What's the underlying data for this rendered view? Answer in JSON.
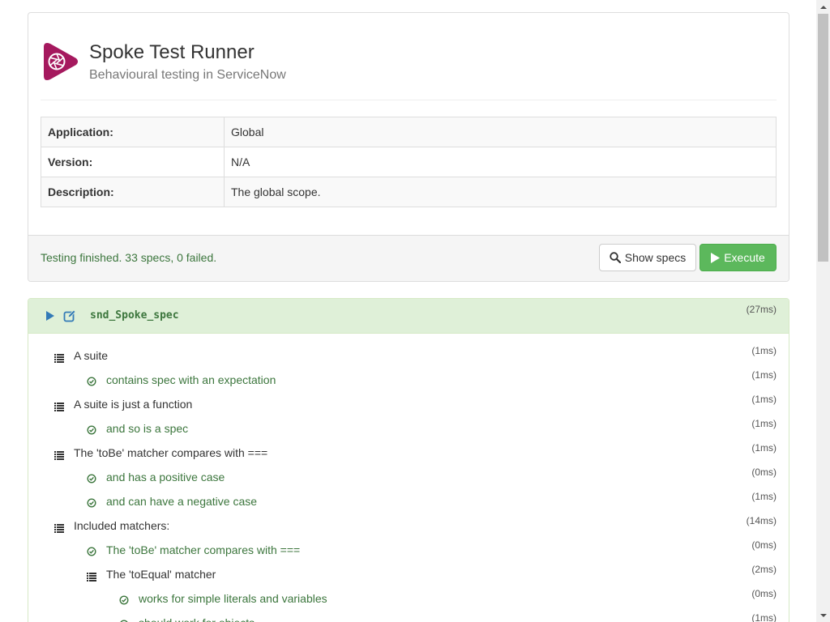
{
  "header": {
    "title": "Spoke Test Runner",
    "subtitle": "Behavioural testing in ServiceNow",
    "logo_color": "#a5195e"
  },
  "info": [
    {
      "label": "Application:",
      "value": "Global"
    },
    {
      "label": "Version:",
      "value": "N/A"
    },
    {
      "label": "Description:",
      "value": "The global scope."
    }
  ],
  "footer": {
    "status": "Testing finished. 33 specs, 0 failed.",
    "show_specs_label": "Show specs",
    "execute_label": "Execute"
  },
  "results": {
    "spec_file": "snd_Spoke_spec",
    "spec_time": "(27ms)",
    "items": [
      {
        "type": "suite",
        "depth": 0,
        "label": "A suite",
        "time": "(1ms)"
      },
      {
        "type": "spec",
        "depth": 1,
        "label": "contains spec with an expectation",
        "time": "(1ms)"
      },
      {
        "type": "suite",
        "depth": 0,
        "label": "A suite is just a function",
        "time": "(1ms)"
      },
      {
        "type": "spec",
        "depth": 1,
        "label": "and so is a spec",
        "time": "(1ms)"
      },
      {
        "type": "suite",
        "depth": 0,
        "label": "The 'toBe' matcher compares with ===",
        "time": "(1ms)"
      },
      {
        "type": "spec",
        "depth": 1,
        "label": "and has a positive case",
        "time": "(0ms)"
      },
      {
        "type": "spec",
        "depth": 1,
        "label": "and can have a negative case",
        "time": "(1ms)"
      },
      {
        "type": "suite",
        "depth": 0,
        "label": "Included matchers:",
        "time": "(14ms)"
      },
      {
        "type": "spec",
        "depth": 1,
        "label": "The 'toBe' matcher compares with ===",
        "time": "(0ms)"
      },
      {
        "type": "suite",
        "depth": 1,
        "label": "The 'toEqual' matcher",
        "time": "(2ms)"
      },
      {
        "type": "spec",
        "depth": 2,
        "label": "works for simple literals and variables",
        "time": "(0ms)"
      },
      {
        "type": "spec",
        "depth": 2,
        "label": "should work for objects",
        "time": "(1ms)"
      }
    ]
  },
  "colors": {
    "success_text": "#3c763d",
    "success_bg": "#dff0d8",
    "execute_button": "#5cb85c",
    "link_blue": "#337ab7"
  }
}
